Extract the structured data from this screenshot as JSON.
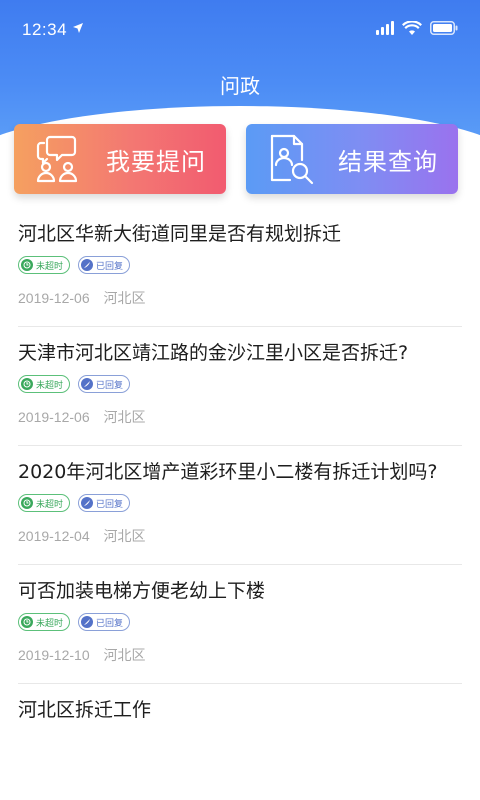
{
  "status_bar": {
    "time": "12:34",
    "icons": [
      "location-arrow-icon",
      "signal-icon",
      "wifi-icon",
      "battery-icon"
    ]
  },
  "nav": {
    "title": "问政"
  },
  "actions": {
    "ask": {
      "label": "我要提问",
      "icon": "chat-users-icon"
    },
    "result": {
      "label": "结果查询",
      "icon": "document-search-icon"
    }
  },
  "questions": [
    {
      "title": "河北区华新大街道同里是否有规划拆迁",
      "tag_time": "未超时",
      "tag_reply": "已回复",
      "date": "2019-12-06",
      "district": "河北区"
    },
    {
      "title": "天津市河北区靖江路的金沙江里小区是否拆迁?",
      "tag_time": "未超时",
      "tag_reply": "已回复",
      "date": "2019-12-06",
      "district": "河北区"
    },
    {
      "title": "2020年河北区增产道彩环里小二楼有拆迁计划吗?",
      "tag_time": "未超时",
      "tag_reply": "已回复",
      "date": "2019-12-04",
      "district": "河北区"
    },
    {
      "title": "可否加装电梯方便老幼上下楼",
      "tag_time": "未超时",
      "tag_reply": "已回复",
      "date": "2019-12-10",
      "district": "河北区"
    },
    {
      "title": "河北区拆迁工作",
      "tag_time": "",
      "tag_reply": "",
      "date": "",
      "district": ""
    }
  ],
  "colors": {
    "header": "#4a86f3",
    "ask_gradient_start": "#f5a060",
    "ask_gradient_end": "#f25b70",
    "result_gradient_start": "#5b9bf5",
    "result_gradient_end": "#9a72ee",
    "tag_time": "#3aa85c",
    "tag_reply": "#5472c8"
  }
}
